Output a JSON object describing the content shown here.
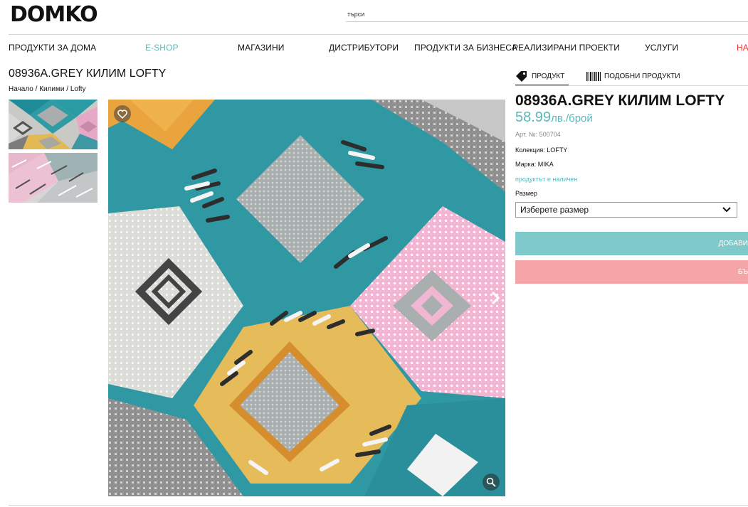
{
  "header": {
    "logo": "DOMKO",
    "search_placeholder": "търси"
  },
  "nav": {
    "items": [
      {
        "label": "ПРОДУКТИ ЗА ДОМА"
      },
      {
        "label": "E-SHOP"
      },
      {
        "label": "МАГАЗИНИ"
      },
      {
        "label": "ДИСТРИБУТОРИ"
      },
      {
        "label": "ПРОДУКТИ ЗА БИЗНЕСА"
      },
      {
        "label": "РЕАЛИЗИРАНИ ПРОЕКТИ"
      },
      {
        "label": "УСЛУГИ"
      },
      {
        "label": "НА"
      }
    ],
    "accent_color": "#5bb7b8",
    "sale_color": "#ee3333"
  },
  "page": {
    "title": "08936A.GREY КИЛИМ LOFTY",
    "breadcrumb": [
      "Начало",
      "Килими",
      "Lofty"
    ],
    "breadcrumb_sep": " / "
  },
  "gallery": {
    "thumbnails": [
      "thumbnail-1",
      "thumbnail-2"
    ],
    "icons": {
      "favorite": "heart-icon",
      "next": "chevron-right-icon",
      "zoom": "magnifier-icon"
    }
  },
  "product": {
    "tabs": [
      {
        "label": "ПРОДУКТ",
        "icon": "tag-icon",
        "active": true
      },
      {
        "label": "ПОДОБНИ ПРОДУКТИ",
        "icon": "barcode-icon",
        "active": false
      }
    ],
    "name": "08936A.GREY КИЛИМ LOFTY",
    "price": "58.99",
    "price_unit": "лв./брой",
    "article": "Арт. №: 500704",
    "collection": "Колекция: LOFTY",
    "brand": "Марка: MIKA",
    "availability": "продуктът е наличен",
    "size_label": "Размер",
    "size_select_value": "Изберете размер",
    "add_button_label": "ДОБАВИ",
    "buy_button_label": "БЪ",
    "price_color": "#5bb7b8",
    "add_button_color": "#7fc9cb",
    "buy_button_color": "#f5a4a8"
  }
}
